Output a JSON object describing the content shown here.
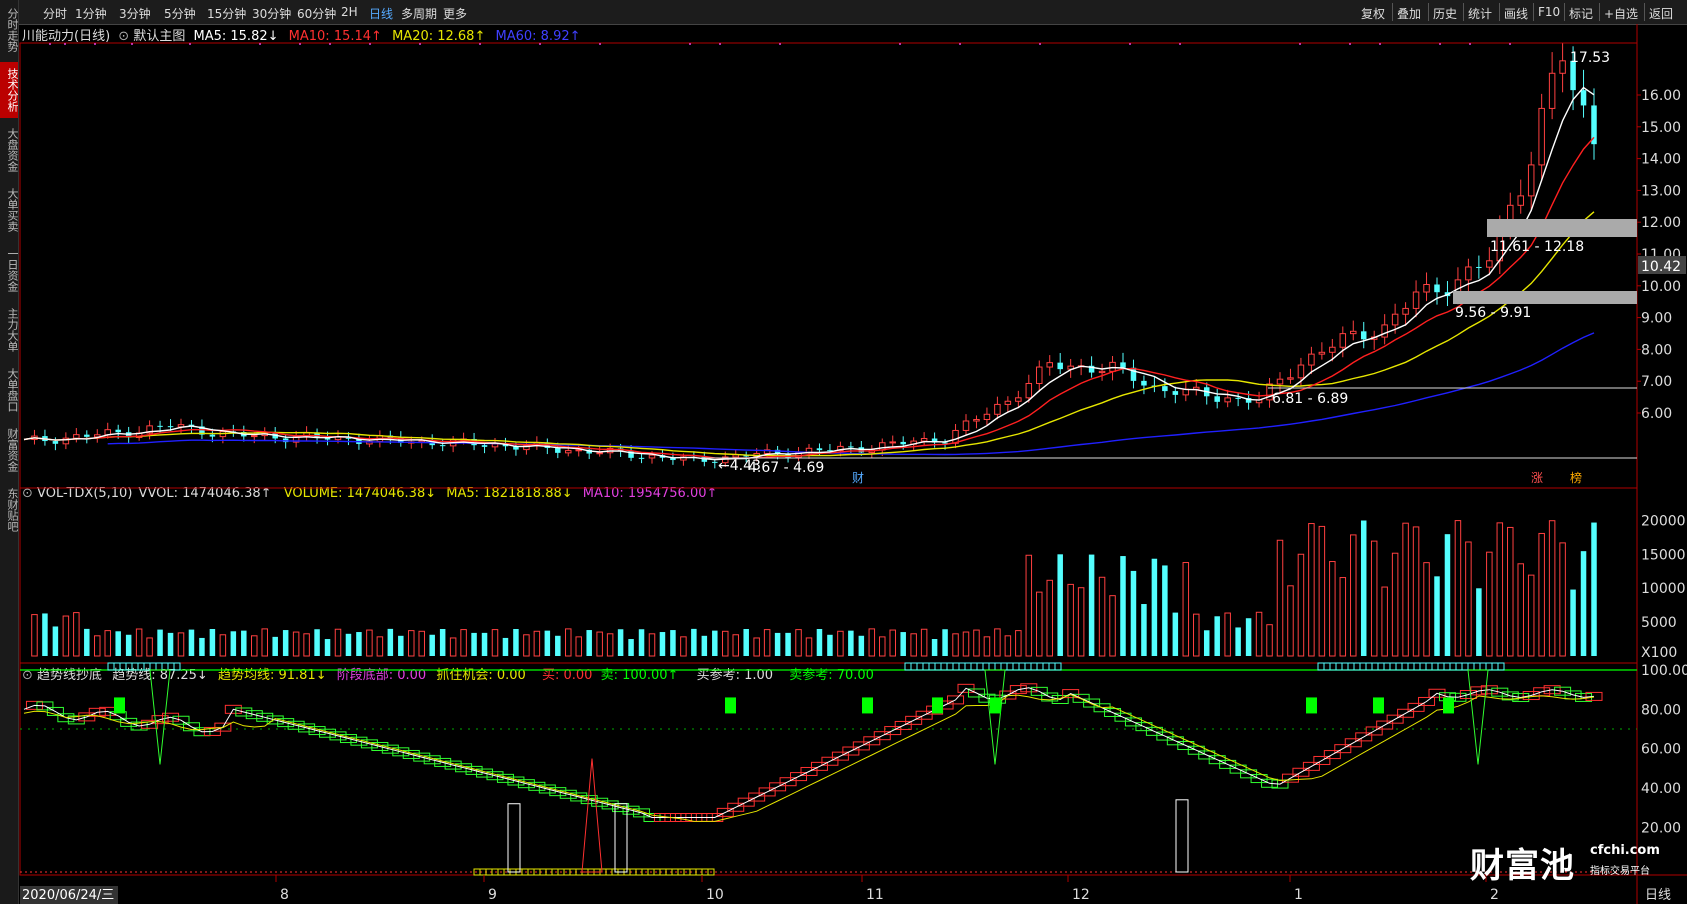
{
  "sidebar": {
    "tabs": [
      {
        "label": "分时走势",
        "active": false
      },
      {
        "label": "技术分析",
        "active": true
      },
      {
        "label": "大盘资金",
        "active": false
      },
      {
        "label": "大单买卖",
        "active": false
      },
      {
        "label": "一日资金",
        "active": false
      },
      {
        "label": "主力大单",
        "active": false
      },
      {
        "label": "大单盘口",
        "active": false
      },
      {
        "label": "财富资金",
        "active": false
      },
      {
        "label": "东财贴吧",
        "active": false
      }
    ]
  },
  "toolbar": {
    "periods": [
      "分时",
      "1分钟",
      "3分钟",
      "5分钟",
      "15分钟",
      "30分钟",
      "60分钟",
      "2H",
      "日线",
      "多周期",
      "更多"
    ],
    "active_period": "日线",
    "right_buttons": [
      "复权",
      "叠加",
      "历史",
      "统计",
      "画线",
      "F10",
      "标记",
      "+自选",
      "返回"
    ]
  },
  "main_panel": {
    "stock": "川能动力(日线)",
    "indicator": "默认主图",
    "ma5": "MA5: 15.82↓",
    "ma10": "MA10: 15.14↑",
    "ma20": "MA20: 12.68↑",
    "ma60": "MA60: 8.92↑",
    "price_axis": [
      "16.00",
      "15.00",
      "14.00",
      "13.00",
      "12.00",
      "11.00",
      "10.00",
      "9.00",
      "8.00",
      "7.00",
      "6.00"
    ],
    "current_price": "10.42",
    "annotations": {
      "high": "17.53",
      "zone1": "11.61 - 12.18",
      "zone2": "9.56 - 9.91",
      "zone3": "6.81 - 6.89",
      "zone4": "4.67 - 4.69",
      "low": "4.43"
    },
    "markers": {
      "cai": "财",
      "zhang": "涨",
      "bang": "榜"
    }
  },
  "volume_panel": {
    "title": "VOL-TDX(5,10)",
    "vvol": "VVOL: 1474046.38↑",
    "volume": "VOLUME: 1474046.38↓",
    "ma5": "MA5: 1821818.88↓",
    "ma10": "MA10: 1954756.00↑",
    "axis": [
      "20000",
      "15000",
      "10000",
      "5000"
    ],
    "unit": "X100"
  },
  "trend_panel": {
    "title": "趋势线抄底",
    "trend": "趋势线: 87.25↓",
    "avg": "趋势均线: 91.81↓",
    "bottom": "阶段底部: 0.00",
    "chance": "抓住机会: 0.00",
    "buy": "买: 0.00",
    "sell": "卖: 100.00↑",
    "buy_ref": "买参考: 1.00",
    "sell_ref": "卖参考: 70.00",
    "axis": [
      "100.00",
      "80.00",
      "60.00",
      "40.00",
      "20.00"
    ]
  },
  "x_axis": {
    "start_date": "2020/06/24/三",
    "months": [
      "8",
      "9",
      "10",
      "11",
      "12",
      "1",
      "2"
    ],
    "period_label": "日线"
  },
  "logo": {
    "main": "财富池",
    "domain": "cfchi.com",
    "sub": "指标交易平台"
  },
  "colors": {
    "up": "#ff4040",
    "down": "#54ffff",
    "ma5": "#ffffff",
    "ma10": "#ff2020",
    "ma20": "#e6e600",
    "ma60": "#2020ff",
    "purple": "#e040e0",
    "green": "#00ff00"
  }
}
